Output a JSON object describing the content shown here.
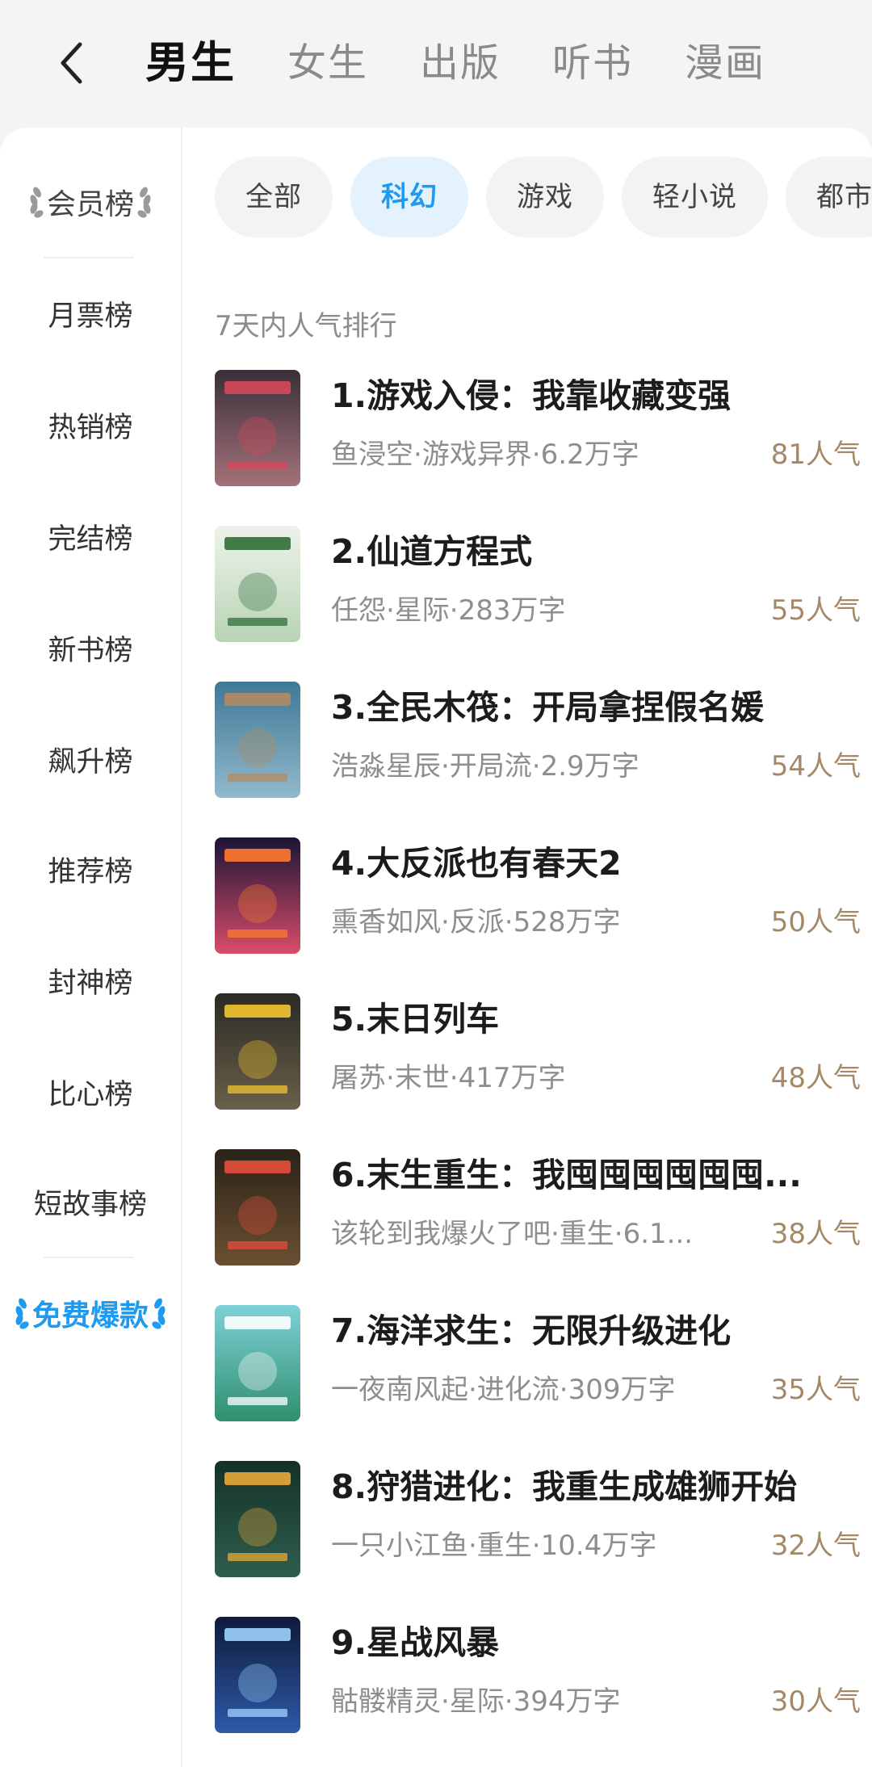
{
  "header": {
    "tabs": [
      {
        "label": "男生",
        "active": true
      },
      {
        "label": "女生"
      },
      {
        "label": "出版"
      },
      {
        "label": "听书"
      },
      {
        "label": "漫画"
      }
    ],
    "accent": "#1e9bf0"
  },
  "sidebar": {
    "items": [
      {
        "label": "会员榜",
        "style": "laurel"
      },
      {
        "label": "月票榜"
      },
      {
        "label": "热销榜"
      },
      {
        "label": "完结榜"
      },
      {
        "label": "新书榜"
      },
      {
        "label": "飙升榜"
      },
      {
        "label": "推荐榜"
      },
      {
        "label": "封神榜"
      },
      {
        "label": "比心榜"
      },
      {
        "label": "短故事榜"
      },
      {
        "label": "免费爆款",
        "style": "laurel-blue",
        "selected": true
      }
    ]
  },
  "filters": {
    "chips": [
      {
        "label": "全部"
      },
      {
        "label": "科幻",
        "active": true
      },
      {
        "label": "游戏"
      },
      {
        "label": "轻小说"
      },
      {
        "label": "都市"
      }
    ]
  },
  "ranking": {
    "section_title": "7天内人气排行",
    "books": [
      {
        "title": "1.游戏入侵：我靠收藏变强",
        "meta": "鱼浸空·游戏异界·6.2万字",
        "popularity": "81人气",
        "cover": [
          "#3a2f3a",
          "#a3727a",
          "#d6495a"
        ]
      },
      {
        "title": "2.仙道方程式",
        "meta": "任怨·星际·283万字",
        "popularity": "55人气",
        "cover": [
          "#eef3ea",
          "#b8d3b4",
          "#2f6e3a"
        ]
      },
      {
        "title": "3.全民木筏：开局拿捏假名媛",
        "meta": "浩淼星辰·开局流·2.9万字",
        "popularity": "54人气",
        "cover": [
          "#3f7896",
          "#92b9cc",
          "#b38b62"
        ]
      },
      {
        "title": "4.大反派也有春天2",
        "meta": "熏香如风·反派·528万字",
        "popularity": "50人气",
        "cover": [
          "#1c1436",
          "#d94c6a",
          "#ff7a2e"
        ]
      },
      {
        "title": "5.末日列车",
        "meta": "屠苏·末世·417万字",
        "popularity": "48人气",
        "cover": [
          "#2b2a24",
          "#6a5f4a",
          "#f2c630"
        ]
      },
      {
        "title": "6.末生重生：我囤囤囤囤囤囤...",
        "meta": "该轮到我爆火了吧·重生·6.1...",
        "popularity": "38人气",
        "cover": [
          "#2a2218",
          "#6b5032",
          "#e74c3c"
        ]
      },
      {
        "title": "7.海洋求生：无限升级进化",
        "meta": "一夜南风起·进化流·309万字",
        "popularity": "35人气",
        "cover": [
          "#7fd0d8",
          "#2f8f6e",
          "#ffffff"
        ]
      },
      {
        "title": "8.狩猎进化：我重生成雄狮开始",
        "meta": "一只小江鱼·重生·10.4万字",
        "popularity": "32人气",
        "cover": [
          "#143128",
          "#2f5e4e",
          "#e9a93a"
        ]
      },
      {
        "title": "9.星战风暴",
        "meta": "骷髅精灵·星际·394万字",
        "popularity": "30人气",
        "cover": [
          "#0e1a3a",
          "#2e5aa8",
          "#9fd3ff"
        ]
      }
    ]
  }
}
